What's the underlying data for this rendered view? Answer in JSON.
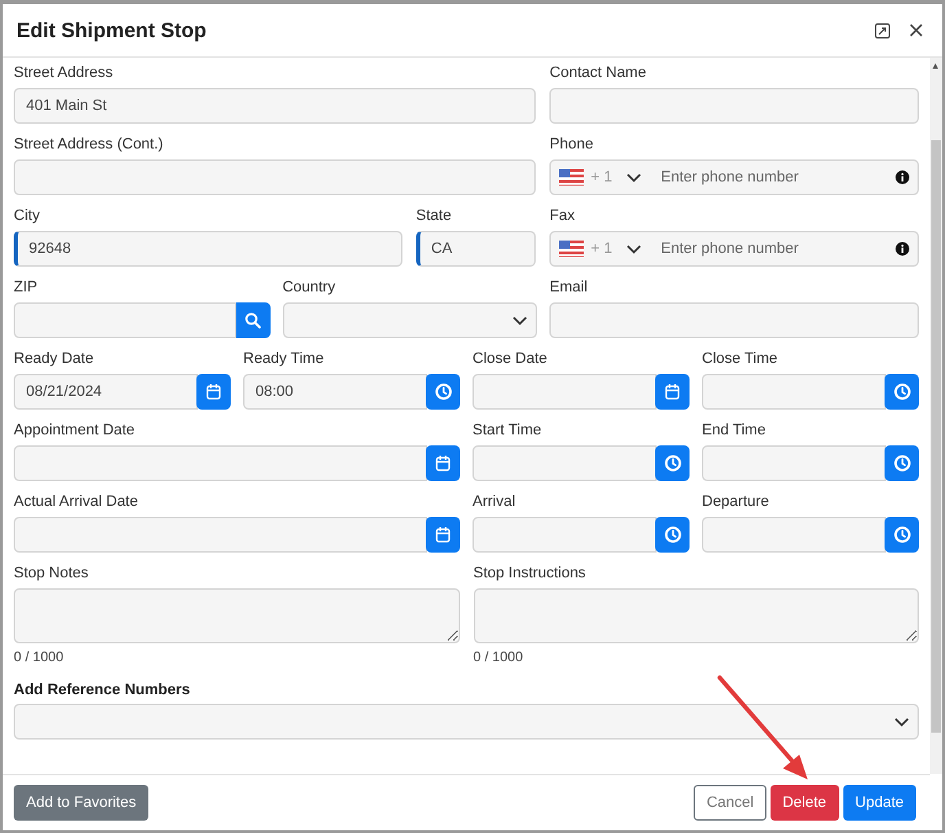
{
  "dialog": {
    "title": "Edit Shipment Stop"
  },
  "rows": [
    [
      {
        "kind": "text",
        "label": "Street Address",
        "value": "401 Main St",
        "required": false
      },
      {
        "kind": "text",
        "label": "Contact Name",
        "required": false
      }
    ],
    [
      {
        "kind": "text",
        "label": "Street Address (Cont.)",
        "required": false
      },
      {
        "kind": "phone",
        "label": "Phone",
        "country_code": "+ 1",
        "placeholder": "Enter phone number",
        "required": false
      }
    ],
    [
      {
        "kind": "text",
        "label": "City",
        "value": "92648",
        "required": true
      },
      {
        "kind": "text",
        "label": "State",
        "value": "CA",
        "required": true
      },
      {
        "kind": "phone",
        "label": "Fax",
        "country_code": "+ 1",
        "placeholder": "Enter phone number",
        "required": false
      }
    ],
    [
      {
        "kind": "zip",
        "label": "ZIP",
        "required": false
      },
      {
        "kind": "select",
        "label": "Country",
        "required": false
      },
      {
        "kind": "text",
        "label": "Email",
        "required": false
      }
    ],
    [
      {
        "kind": "date",
        "label": "Ready Date",
        "value": "08/21/2024",
        "required": false
      },
      {
        "kind": "time",
        "label": "Ready Time",
        "value": "08:00",
        "required": false
      },
      {
        "kind": "date",
        "label": "Close Date",
        "required": false
      },
      {
        "kind": "time",
        "label": "Close Time",
        "required": false
      }
    ],
    [
      {
        "kind": "date",
        "label": "Appointment Date",
        "required": false
      },
      {
        "kind": "time",
        "label": "Start Time",
        "required": false
      },
      {
        "kind": "time",
        "label": "End Time",
        "required": false
      }
    ],
    [
      {
        "kind": "date",
        "label": "Actual Arrival Date",
        "required": false
      },
      {
        "kind": "time",
        "label": "Arrival",
        "required": false
      },
      {
        "kind": "time",
        "label": "Departure",
        "required": false
      }
    ],
    [
      {
        "kind": "textarea",
        "label": "Stop Notes",
        "counter": "0 / 1000",
        "required": false
      },
      {
        "kind": "textarea",
        "label": "Stop Instructions",
        "counter": "0 / 1000",
        "required": false
      }
    ]
  ],
  "reference_numbers": {
    "label": "Add Reference Numbers"
  },
  "footer": {
    "buttons": [
      {
        "label": "Add to Favorites",
        "kind": "secondary"
      },
      {
        "label": "Cancel",
        "kind": "outline"
      },
      {
        "label": "Delete",
        "kind": "danger"
      },
      {
        "label": "Update",
        "kind": "primary"
      }
    ]
  }
}
